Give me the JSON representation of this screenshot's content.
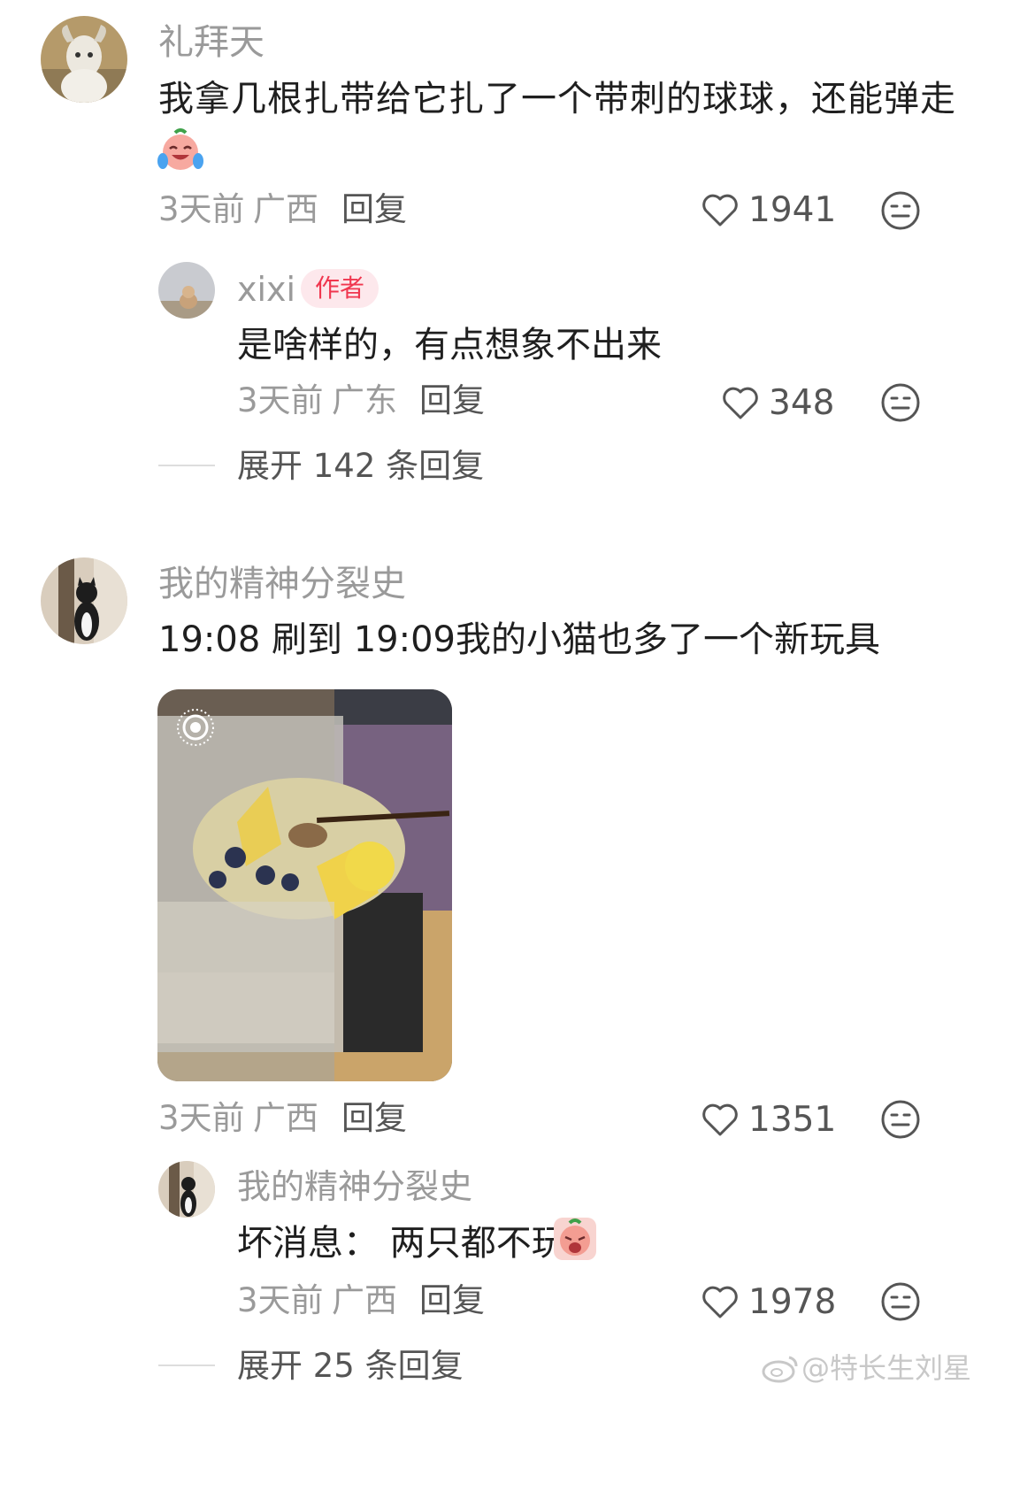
{
  "comments": [
    {
      "username": "礼拜天",
      "text_line1": "我拿几根扎带给它扎了一个带刺的球球，还能弹走",
      "emoji": "laughing-tears-emoji",
      "time": "3天前",
      "location": "广西",
      "reply_label": "回复",
      "likes": "1941",
      "reply": {
        "username": "xixi",
        "badge": "作者",
        "text": "是啥样的，有点想象不出来",
        "time": "3天前",
        "location": "广东",
        "reply_label": "回复",
        "likes": "348"
      },
      "expand": "展开 142 条回复"
    },
    {
      "username": "我的精神分裂史",
      "text": "19:08 刷到 19:09我的小猫也多了一个新玩具",
      "media": "photo-of-fruit-bowl-in-plastic-bag",
      "media_icon": "live-photo-icon",
      "time": "3天前",
      "location": "广西",
      "reply_label": "回复",
      "likes": "1351",
      "reply": {
        "username": "我的精神分裂史",
        "text": "坏消息： 两只都不玩",
        "emoji": "crying-emoji",
        "time": "3天前",
        "location": "广西",
        "reply_label": "回复",
        "likes": "1978"
      },
      "expand": "展开 25 条回复"
    }
  ],
  "watermark": "@特长生刘星",
  "colors": {
    "muted": "#9a9a9a",
    "text": "#1f1f1f",
    "badge_bg": "#fde8ec",
    "badge_fg": "#f0374f"
  }
}
